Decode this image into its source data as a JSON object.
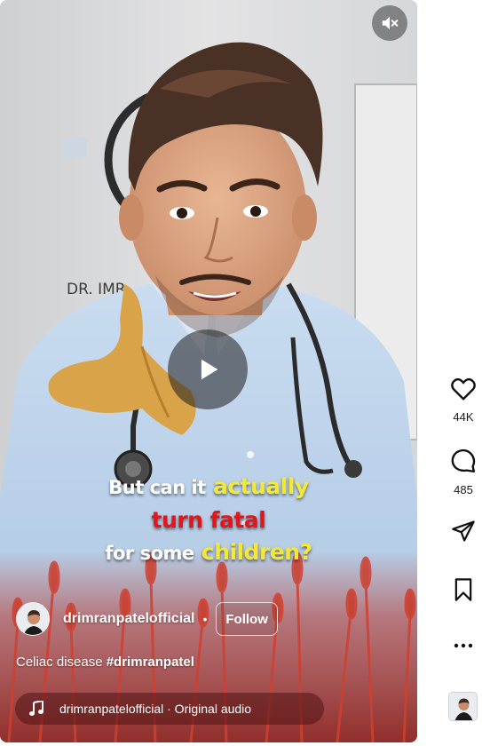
{
  "video": {
    "caption_line1": [
      "But can it",
      "actually"
    ],
    "caption_line2": "turn fatal",
    "caption_line3": [
      "for some",
      "children?"
    ],
    "wall_sign": "DR. IMR",
    "mute_icon": "muted-speaker-icon",
    "play_icon": "play-icon"
  },
  "author": {
    "username": "drimranpatelofficial",
    "separator": "•",
    "follow_label": "Follow"
  },
  "description": {
    "text": "Celiac disease ",
    "hashtag": "#drimranpatel"
  },
  "audio": {
    "icon": "music-note-icon",
    "label": "drimranpatelofficial · Original audio"
  },
  "actions": {
    "like": {
      "icon": "heart-icon",
      "count": "44K"
    },
    "comment": {
      "icon": "comment-icon",
      "count": "485"
    },
    "share": {
      "icon": "send-icon"
    },
    "save": {
      "icon": "bookmark-icon"
    },
    "more": {
      "icon": "more-dots-icon"
    }
  },
  "colors": {
    "caption_yellow": "#f3e83a",
    "caption_red": "#e3151a",
    "caption_white": "#ffffff",
    "shirt_blue": "#bdd3ec",
    "wheat_red": "#c0392b"
  }
}
